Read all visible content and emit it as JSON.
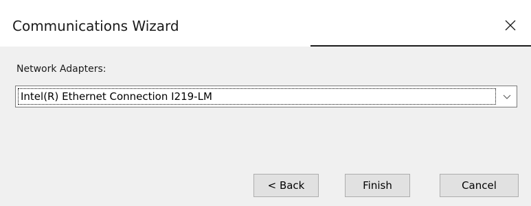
{
  "window": {
    "title": "Communications Wizard",
    "close_icon": "close-icon"
  },
  "form": {
    "network_adapters_label": "Network Adapters:",
    "network_adapter_selected": "Intel(R) Ethernet Connection I219-LM",
    "dropdown_icon": "chevron-down-icon"
  },
  "buttons": {
    "back_label": "< Back",
    "finish_label": "Finish",
    "cancel_label": "Cancel"
  },
  "colors": {
    "body_background": "#f0f0f0",
    "title_background": "#ffffff",
    "button_background": "#e1e1e1",
    "button_border": "#adadad"
  }
}
